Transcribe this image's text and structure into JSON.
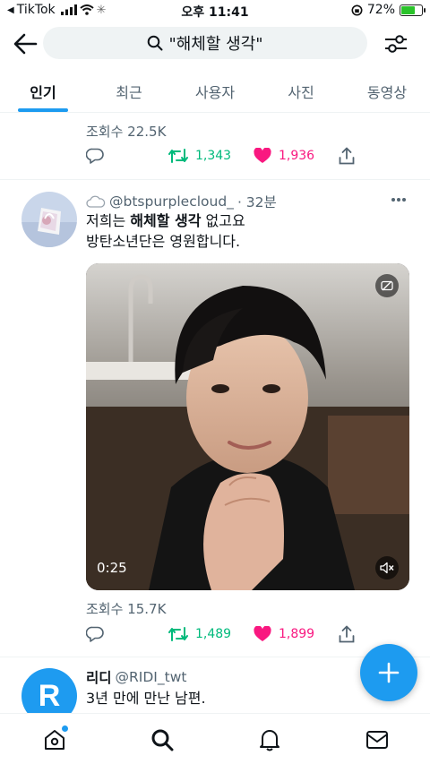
{
  "status_bar": {
    "back_app": "TikTok",
    "time": "오후 11:41",
    "battery": "72%",
    "battery_level": 0.72
  },
  "search": {
    "query": "\"해체할 생각\""
  },
  "tabs": [
    {
      "label": "인기",
      "active": true
    },
    {
      "label": "최근",
      "active": false
    },
    {
      "label": "사용자",
      "active": false
    },
    {
      "label": "사진",
      "active": false
    },
    {
      "label": "동영상",
      "active": false
    }
  ],
  "tweet1": {
    "views": "조회수 22.5K",
    "retweets": "1,343",
    "likes": "1,936"
  },
  "tweet2": {
    "handle": "@btspurplecloud_",
    "time": "· 32분",
    "text_pre": "저희는 ",
    "text_bold": "해체할 생각",
    "text_post": " 없고요",
    "text_line2": "방탄소년단은 영원합니다.",
    "video_duration": "0:25",
    "views": "조회수 15.7K",
    "retweets": "1,489",
    "likes": "1,899"
  },
  "tweet3": {
    "name": "리디",
    "handle": "@RIDI_twt",
    "avatar_letter": "R",
    "text": "3년 만에 만난 남편."
  },
  "colors": {
    "accent": "#1d9bf0",
    "retweet": "#00ba7c",
    "like": "#f91880",
    "secondary": "#536471"
  }
}
